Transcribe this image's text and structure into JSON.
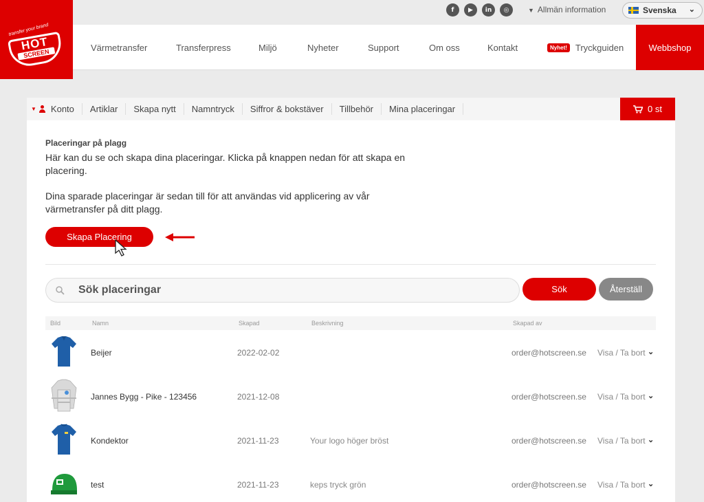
{
  "topbar": {
    "social": [
      "f",
      "▶",
      "in",
      "◎"
    ],
    "social_icons": [
      "facebook-icon",
      "youtube-icon",
      "linkedin-icon",
      "instagram-icon"
    ],
    "info_link": "Allmän information",
    "language": "Svenska"
  },
  "logo": {
    "tagline": "transfer your brand",
    "hot": "HOT",
    "screen": "SCREEN"
  },
  "nav": {
    "items": [
      "Värmetransfer",
      "Transferpress",
      "Miljö",
      "Nyheter",
      "Support",
      "Om oss",
      "Kontakt"
    ],
    "badge": "Nyhet!",
    "guide": "Tryckguiden",
    "shop": "Webbshop"
  },
  "subnav": {
    "items": [
      "Konto",
      "Artiklar",
      "Skapa nytt",
      "Namntryck",
      "Siffror & bokstäver",
      "Tillbehör",
      "Mina placeringar"
    ],
    "cart": "0 st"
  },
  "main": {
    "section_title": "Placeringar på plagg",
    "paragraph1": "Här kan du se och skapa dina placeringar. Klicka på knappen nedan för att skapa en placering.",
    "paragraph2": "Dina sparade placeringar är sedan till för att användas vid applicering av vår värmetransfer på ditt plagg.",
    "create_button": "Skapa Placering"
  },
  "search": {
    "placeholder": "Sök placeringar",
    "search_button": "Sök",
    "reset_button": "Återställ"
  },
  "table": {
    "headers": [
      "Bild",
      "Namn",
      "Skapad",
      "Beskrivning",
      "Skapad av"
    ],
    "rows": [
      {
        "name": "Beijer",
        "created": "2022-02-02",
        "description": "",
        "created_by": "order@hotscreen.se",
        "action": "Visa / Ta bort",
        "image": "blue-polo-icon"
      },
      {
        "name": "Jannes Bygg - Pike - 123456",
        "created": "2021-12-08",
        "description": "",
        "created_by": "order@hotscreen.se",
        "action": "Visa / Ta bort",
        "image": "grey-hivis-jacket-icon"
      },
      {
        "name": "Kondektor",
        "created": "2021-11-23",
        "description": "Your logo höger bröst",
        "created_by": "order@hotscreen.se",
        "action": "Visa / Ta bort",
        "image": "blue-tshirt-icon"
      },
      {
        "name": "test",
        "created": "2021-11-23",
        "description": "keps tryck grön",
        "created_by": "order@hotscreen.se",
        "action": "Visa / Ta bort",
        "image": "green-cap-icon"
      }
    ]
  },
  "colors": {
    "brand_red": "#dd0000",
    "reset_grey": "#888888"
  }
}
